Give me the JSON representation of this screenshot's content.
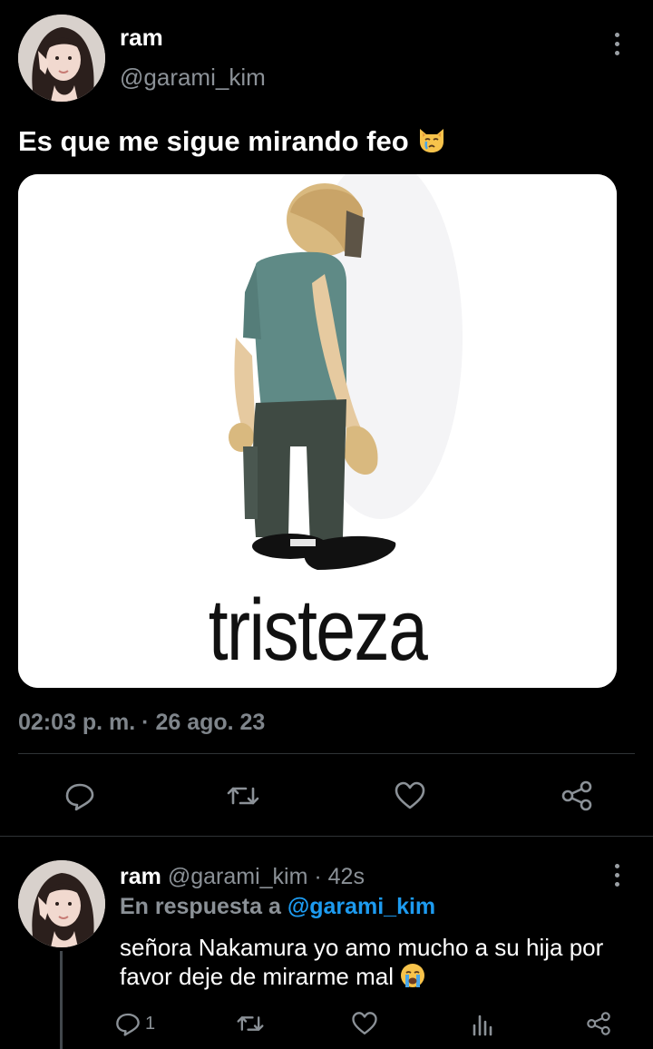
{
  "main_tweet": {
    "name": "ram",
    "handle": "@garami_kim",
    "text": "Es que me sigue mirando feo",
    "emoji": "crying-cat-emoji",
    "image_caption": "tristeza",
    "timestamp": "02:03 p. m. · 26 ago. 23",
    "actions": [
      {
        "name": "reply",
        "icon": "reply-icon"
      },
      {
        "name": "retweet",
        "icon": "retweet-icon"
      },
      {
        "name": "like",
        "icon": "heart-icon"
      },
      {
        "name": "share",
        "icon": "share-icon"
      }
    ]
  },
  "reply_tweet": {
    "name": "ram",
    "handle": "@garami_kim",
    "time": "· 42s",
    "replying_prefix": "En respuesta a",
    "replying_to": "@garami_kim",
    "text": "señora Nakamura yo amo mucho a su hija por favor deje de mirarme mal",
    "emoji": "loudly-crying-emoji",
    "reply_count": "1",
    "actions": [
      {
        "name": "reply",
        "icon": "reply-icon"
      },
      {
        "name": "retweet",
        "icon": "retweet-icon"
      },
      {
        "name": "like",
        "icon": "heart-icon"
      },
      {
        "name": "analytics",
        "icon": "analytics-icon"
      },
      {
        "name": "share",
        "icon": "share-icon"
      }
    ]
  },
  "colors": {
    "background": "#000000",
    "text": "#e7e9ea",
    "secondary": "#8b9197",
    "link": "#1d9bf0",
    "divider": "#2f3336"
  }
}
